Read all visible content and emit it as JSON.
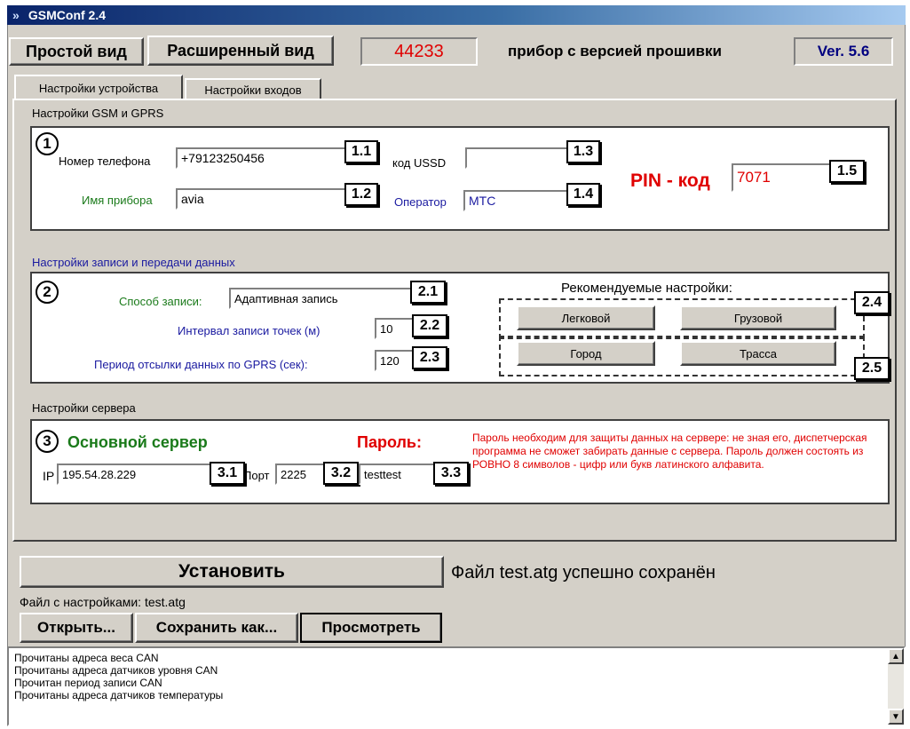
{
  "app": {
    "title": "GSMConf 2.4"
  },
  "toolbar": {
    "simple_view": "Простой вид",
    "extended_view": "Расширенный вид",
    "device_id": "44233",
    "firmware_label": "прибор с версией прошивки",
    "version": "Ver. 5.6"
  },
  "tabs": [
    {
      "label": "Настройки устройства"
    },
    {
      "label": "Настройки входов"
    }
  ],
  "gsm": {
    "section_title": "Настройки GSM и GPRS",
    "marker": "1",
    "phone_label": "Номер телефона",
    "phone_value": "+79123250456",
    "phone_tag": "1.1",
    "device_name_label": "Имя прибора",
    "device_name_value": "avia",
    "device_name_tag": "1.2",
    "ussd_label": "код USSD",
    "ussd_value": "",
    "ussd_tag": "1.3",
    "operator_label": "Оператор",
    "operator_value": "МТС",
    "operator_tag": "1.4",
    "pin_label": "PIN - код",
    "pin_value": "7071",
    "pin_tag": "1.5"
  },
  "recording": {
    "section_title": "Настройки записи и передачи данных",
    "marker": "2",
    "method_label": "Способ записи:",
    "method_value": "Адаптивная запись",
    "method_tag": "2.1",
    "interval_label": "Интервал записи точек (м)",
    "interval_value": "10",
    "interval_tag": "2.2",
    "period_label": "Период отсылки данных по GPRS (сек):",
    "period_value": "120",
    "period_tag": "2.3",
    "recommended_title": "Рекомендуемые настройки:",
    "preset_car": "Легковой",
    "preset_truck": "Грузовой",
    "preset_city": "Город",
    "preset_highway": "Трасса",
    "preset_tag_vehicle": "2.4",
    "preset_tag_road": "2.5"
  },
  "server": {
    "section_title": "Настройки сервера",
    "marker": "3",
    "main_server_label": "Основной сервер",
    "ip_label": "IP",
    "ip_value": "195.54.28.229",
    "ip_tag": "3.1",
    "port_label": "Порт",
    "port_value": "2225",
    "port_tag": "3.2",
    "password_label": "Пароль:",
    "password_value": "testtest",
    "password_tag": "3.3",
    "password_note": "Пароль необходим для защиты данных на сервере: не зная его, диспетчерская программа не сможет забирать данные с сервера. Пароль должен состоять из РОВНО 8 символов - цифр или букв латинского алфавита."
  },
  "actions": {
    "install": "Установить",
    "status": "Файл test.atg успешно сохранён",
    "file_label": "Файл с настройками: test.atg",
    "open": "Открыть...",
    "save_as": "Сохранить как...",
    "view": "Просмотреть"
  },
  "log": {
    "lines": [
      "Прочитаны адреса веса CAN",
      "Прочитаны адреса датчиков уровня CAN",
      "Прочитан период записи CAN",
      "Прочитаны адреса датчиков температуры"
    ]
  },
  "colors": {
    "device_id": "#e00000",
    "version": "#000080",
    "green_label": "#1a7a1a",
    "blue_label": "#1a1aa0",
    "red_label": "#e00000"
  }
}
